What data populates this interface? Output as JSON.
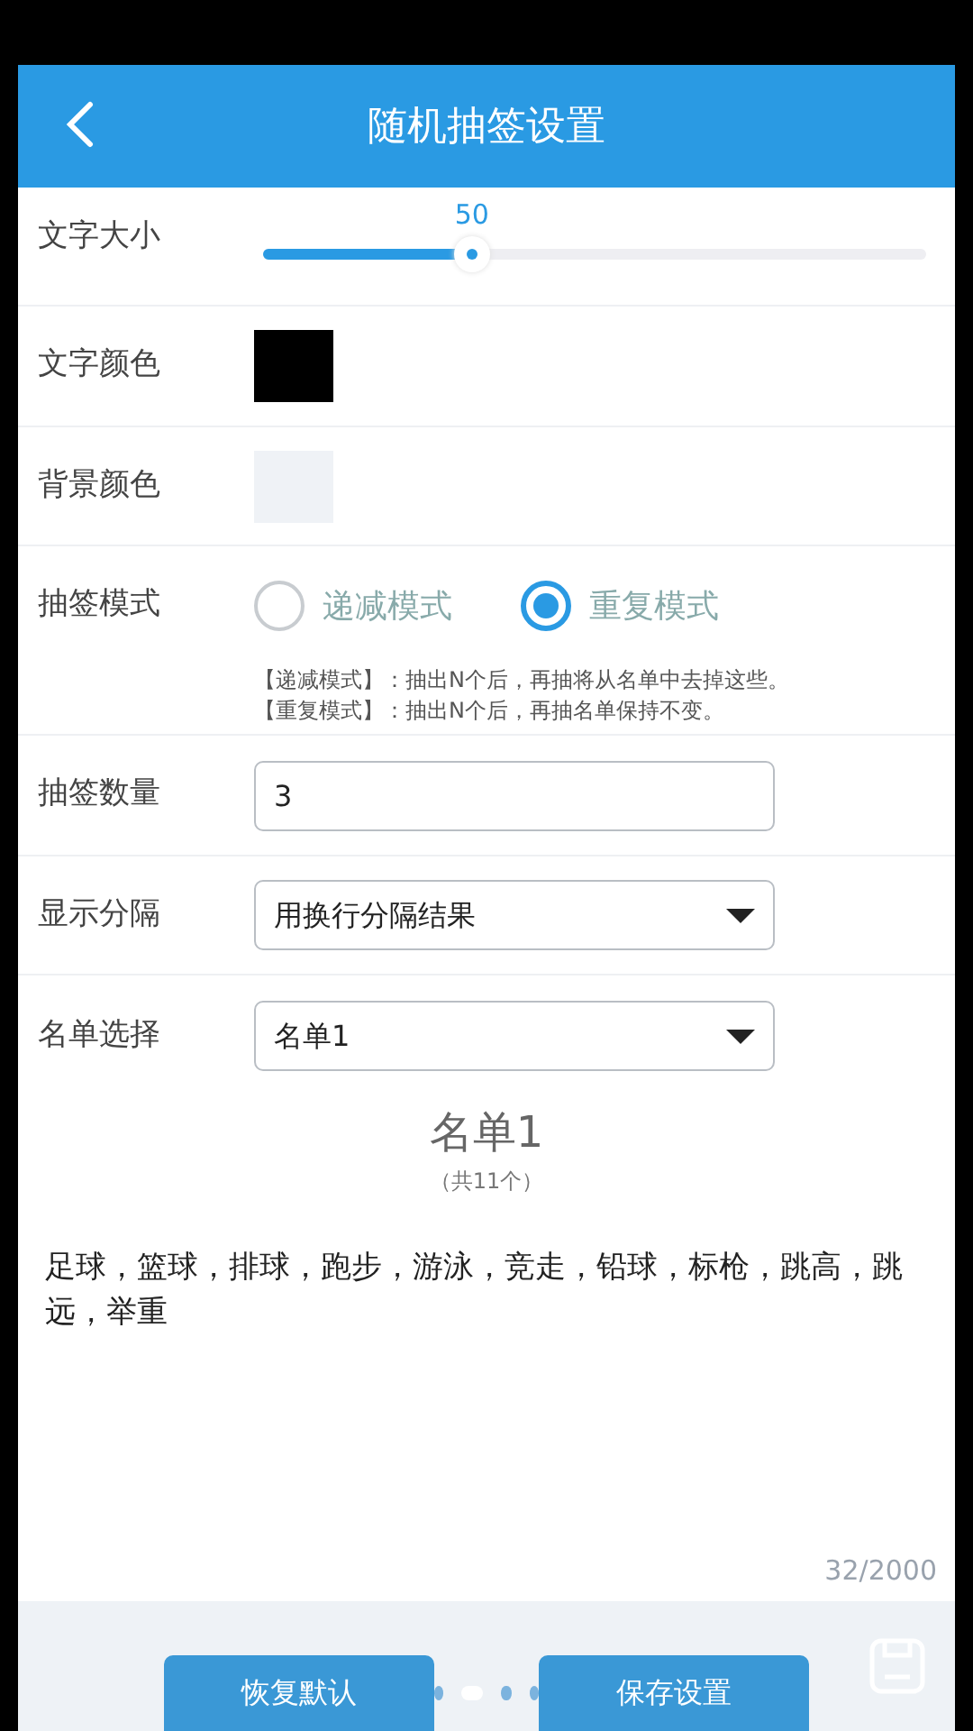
{
  "header": {
    "title": "随机抽签设置"
  },
  "font_size": {
    "label": "文字大小",
    "reading": "50",
    "level": 0.3
  },
  "text_color": {
    "label": "文字颜色",
    "color": "#000000"
  },
  "bg_color": {
    "label": "背景颜色",
    "color": "#eff2f6"
  },
  "mode": {
    "label": "抽签模式",
    "options": [
      {
        "label": "递减模式",
        "selected": false
      },
      {
        "label": "重复模式",
        "selected": true
      }
    ],
    "notes": [
      "【递减模式】：抽出N个后，再抽将从名单中去掉这些。",
      "【重复模式】：抽出N个后，再抽名单保持不变。"
    ]
  },
  "count": {
    "label": "抽签数量",
    "value": "3"
  },
  "separator": {
    "label": "显示分隔",
    "value": "用换行分隔结果"
  },
  "list_select": {
    "label": "名单选择",
    "value": "名单1"
  },
  "list": {
    "title": "名单1",
    "subtitle": "（共11个）",
    "content": "足球，篮球，排球，跑步，游泳，竞走，铅球，标枪，跳高，跳远，举重",
    "counter": "32/2000"
  },
  "buttons": [
    "恢复默认",
    "保存设置"
  ],
  "page_dots": [
    {
      "selected": false
    },
    {
      "selected": true
    },
    {
      "selected": false
    },
    {
      "selected": false
    }
  ]
}
